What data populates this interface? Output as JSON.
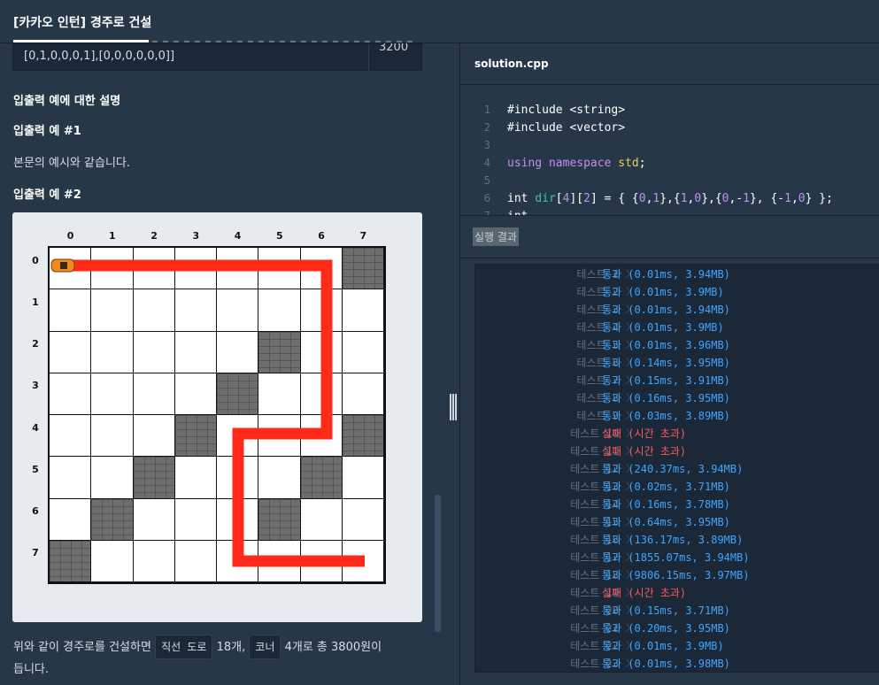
{
  "topbar": {
    "title": "[카카오 인턴] 경주로 건설"
  },
  "example_row": {
    "input_tail": "[0,1,0,0,0,1],[0,0,0,0,0,0]]",
    "output": "3200"
  },
  "explanation": {
    "heading": "입출력 예에 대한 설명",
    "ex1_heading": "입출력 예 #1",
    "ex1_text": "본문의 예시와 같습니다.",
    "ex2_heading": "입출력 예 #2",
    "summary_before": "위와 같이 경주로를 건설하면",
    "chip_straight": "직선 도로",
    "summary_mid1": "18개,",
    "chip_corner": "코너",
    "summary_mid2": "4개로 총 3800원이",
    "summary_end": "듭니다."
  },
  "figure": {
    "col_labels": [
      "0",
      "1",
      "2",
      "3",
      "4",
      "5",
      "6",
      "7"
    ],
    "row_labels": [
      "0",
      "1",
      "2",
      "3",
      "4",
      "5",
      "6",
      "7"
    ],
    "walls": [
      [
        0,
        7
      ],
      [
        2,
        5
      ],
      [
        3,
        4
      ],
      [
        4,
        3
      ],
      [
        4,
        7
      ],
      [
        5,
        2
      ],
      [
        5,
        6
      ],
      [
        6,
        1
      ],
      [
        6,
        5
      ],
      [
        7,
        0
      ]
    ],
    "path_color": "#ff2a1a",
    "car_color": "#f08a1c"
  },
  "editor": {
    "filename": "solution.cpp",
    "lines": [
      {
        "n": "1",
        "text": "#include <string>"
      },
      {
        "n": "2",
        "text": "#include <vector>"
      },
      {
        "n": "3",
        "text": ""
      },
      {
        "n": "4",
        "text": "using namespace std;"
      },
      {
        "n": "5",
        "text": ""
      },
      {
        "n": "6",
        "text": "int dir[4][2] = { {0,1},{1,0},{0,-1}, {-1,0} };"
      },
      {
        "n": "7",
        "text": "int"
      }
    ]
  },
  "results": {
    "header": "실행 결과",
    "rows": [
      {
        "name": "테스트 1",
        "status": "통과 (0.01ms, 3.94MB)",
        "ok": true
      },
      {
        "name": "테스트 2",
        "status": "통과 (0.01ms, 3.9MB)",
        "ok": true
      },
      {
        "name": "테스트 3",
        "status": "통과 (0.01ms, 3.94MB)",
        "ok": true
      },
      {
        "name": "테스트 4",
        "status": "통과 (0.01ms, 3.9MB)",
        "ok": true
      },
      {
        "name": "테스트 5",
        "status": "통과 (0.01ms, 3.96MB)",
        "ok": true
      },
      {
        "name": "테스트 6",
        "status": "통과 (0.14ms, 3.95MB)",
        "ok": true
      },
      {
        "name": "테스트 7",
        "status": "통과 (0.15ms, 3.91MB)",
        "ok": true
      },
      {
        "name": "테스트 8",
        "status": "통과 (0.16ms, 3.95MB)",
        "ok": true
      },
      {
        "name": "테스트 9",
        "status": "통과 (0.03ms, 3.89MB)",
        "ok": true
      },
      {
        "name": "테스트 10",
        "status": "실패 (시간 초과)",
        "ok": false
      },
      {
        "name": "테스트 11",
        "status": "실패 (시간 초과)",
        "ok": false
      },
      {
        "name": "테스트 12",
        "status": "통과 (240.37ms, 3.94MB)",
        "ok": true
      },
      {
        "name": "테스트 13",
        "status": "통과 (0.02ms, 3.71MB)",
        "ok": true
      },
      {
        "name": "테스트 14",
        "status": "통과 (0.16ms, 3.78MB)",
        "ok": true
      },
      {
        "name": "테스트 15",
        "status": "통과 (0.64ms, 3.95MB)",
        "ok": true
      },
      {
        "name": "테스트 16",
        "status": "통과 (136.17ms, 3.89MB)",
        "ok": true
      },
      {
        "name": "테스트 17",
        "status": "통과 (1855.07ms, 3.94MB)",
        "ok": true
      },
      {
        "name": "테스트 18",
        "status": "통과 (9806.15ms, 3.97MB)",
        "ok": true
      },
      {
        "name": "테스트 19",
        "status": "실패 (시간 초과)",
        "ok": false
      },
      {
        "name": "테스트 20",
        "status": "통과 (0.15ms, 3.71MB)",
        "ok": true
      },
      {
        "name": "테스트 21",
        "status": "통과 (0.20ms, 3.95MB)",
        "ok": true
      },
      {
        "name": "테스트 22",
        "status": "통과 (0.01ms, 3.9MB)",
        "ok": true
      },
      {
        "name": "테스트 23",
        "status": "통과 (0.01ms, 3.98MB)",
        "ok": true
      }
    ]
  }
}
